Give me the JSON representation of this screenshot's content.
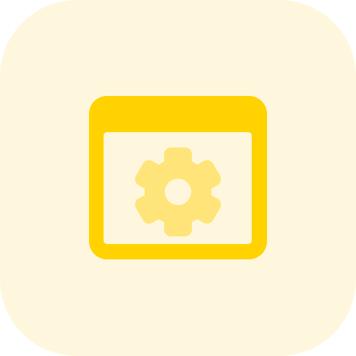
{
  "icon": {
    "name": "browser-settings-icon",
    "parts": [
      "browser-window-icon",
      "gear-icon"
    ]
  },
  "colors": {
    "tile_background": "#fff7dd",
    "window_frame": "#ffd200",
    "window_body": "#fff7dd",
    "gear": "#ffe47a",
    "gear_center": "#fff7dd"
  }
}
